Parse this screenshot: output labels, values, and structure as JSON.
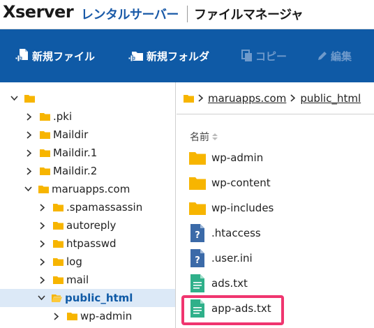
{
  "header": {
    "brand": "Xserver",
    "brand_sub": "レンタルサーバー",
    "app_title": "ファイルマネージャ"
  },
  "toolbar": {
    "new_file": "新規ファイル",
    "new_folder": "新規フォルダ",
    "copy": "コピー",
    "edit": "編集"
  },
  "tree": {
    "items": [
      {
        "label": "",
        "expanded": true
      },
      {
        "label": ".pki",
        "expanded": false
      },
      {
        "label": "Maildir",
        "expanded": false
      },
      {
        "label": "Maildir.1",
        "expanded": false
      },
      {
        "label": "Maildir.2",
        "expanded": false
      },
      {
        "label": "maruapps.com",
        "expanded": true
      },
      {
        "label": ".spamassassin",
        "expanded": false
      },
      {
        "label": "autoreply",
        "expanded": false
      },
      {
        "label": "htpasswd",
        "expanded": false
      },
      {
        "label": "log",
        "expanded": false
      },
      {
        "label": "mail",
        "expanded": false
      },
      {
        "label": "public_html",
        "expanded": true,
        "selected": true
      },
      {
        "label": "wp-admin",
        "expanded": false
      }
    ]
  },
  "breadcrumb": {
    "items": [
      "maruapps.com",
      "public_html"
    ]
  },
  "list": {
    "column_name": "名前",
    "files": [
      {
        "name": "wp-admin",
        "type": "folder"
      },
      {
        "name": "wp-content",
        "type": "folder"
      },
      {
        "name": "wp-includes",
        "type": "folder"
      },
      {
        "name": ".htaccess",
        "type": "unknown"
      },
      {
        "name": ".user.ini",
        "type": "unknown"
      },
      {
        "name": "ads.txt",
        "type": "text"
      },
      {
        "name": "app-ads.txt",
        "type": "text",
        "highlighted": true
      }
    ]
  },
  "colors": {
    "toolbar_bg": "#0f5aa6",
    "folder": "#f7b500",
    "text_file": "#2fb08a",
    "unknown_file": "#3b6aa8",
    "highlight": "#f0356f",
    "selected_row": "#dce9f7"
  }
}
